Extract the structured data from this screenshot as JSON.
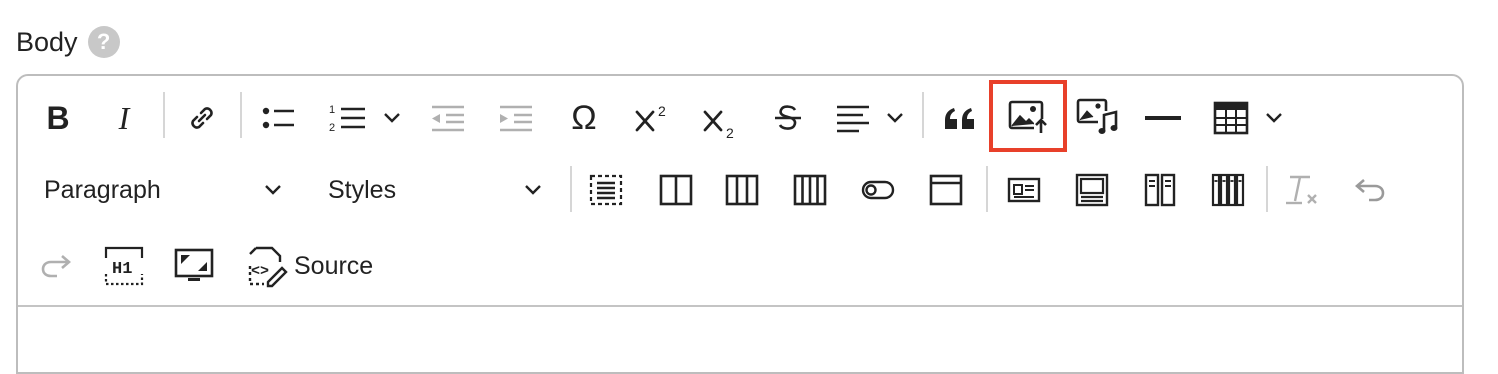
{
  "field": {
    "label": "Body",
    "help_icon": "question-icon",
    "help_text": "?"
  },
  "toolbar": {
    "row1": [
      {
        "name": "bold-button",
        "icon": "bold-icon",
        "text": "B"
      },
      {
        "name": "italic-button",
        "icon": "italic-icon",
        "text": "I"
      },
      {
        "name": "link-button",
        "icon": "link-icon"
      },
      {
        "name": "bulleted-list-button",
        "icon": "bulleted-list-icon"
      },
      {
        "name": "numbered-list-button",
        "icon": "numbered-list-icon"
      },
      {
        "name": "outdent-button",
        "icon": "outdent-icon"
      },
      {
        "name": "indent-button",
        "icon": "indent-icon"
      },
      {
        "name": "special-characters-button",
        "icon": "omega-icon",
        "text": "Ω"
      },
      {
        "name": "superscript-button",
        "icon": "superscript-icon"
      },
      {
        "name": "subscript-button",
        "icon": "subscript-icon"
      },
      {
        "name": "strikethrough-button",
        "icon": "strikethrough-icon"
      },
      {
        "name": "alignment-button",
        "icon": "align-left-icon"
      },
      {
        "name": "blockquote-button",
        "icon": "quote-icon"
      },
      {
        "name": "insert-image-button",
        "icon": "image-upload-icon",
        "highlighted": true
      },
      {
        "name": "insert-media-button",
        "icon": "media-icon"
      },
      {
        "name": "horizontal-line-button",
        "icon": "horizontal-line-icon"
      },
      {
        "name": "insert-table-button",
        "icon": "table-icon"
      }
    ],
    "heading_select": {
      "value": "Paragraph"
    },
    "styles_select": {
      "value": "Styles"
    },
    "source_button": {
      "label": "Source"
    },
    "heading_badge": "H1",
    "highlight_color": "#e8402a"
  }
}
